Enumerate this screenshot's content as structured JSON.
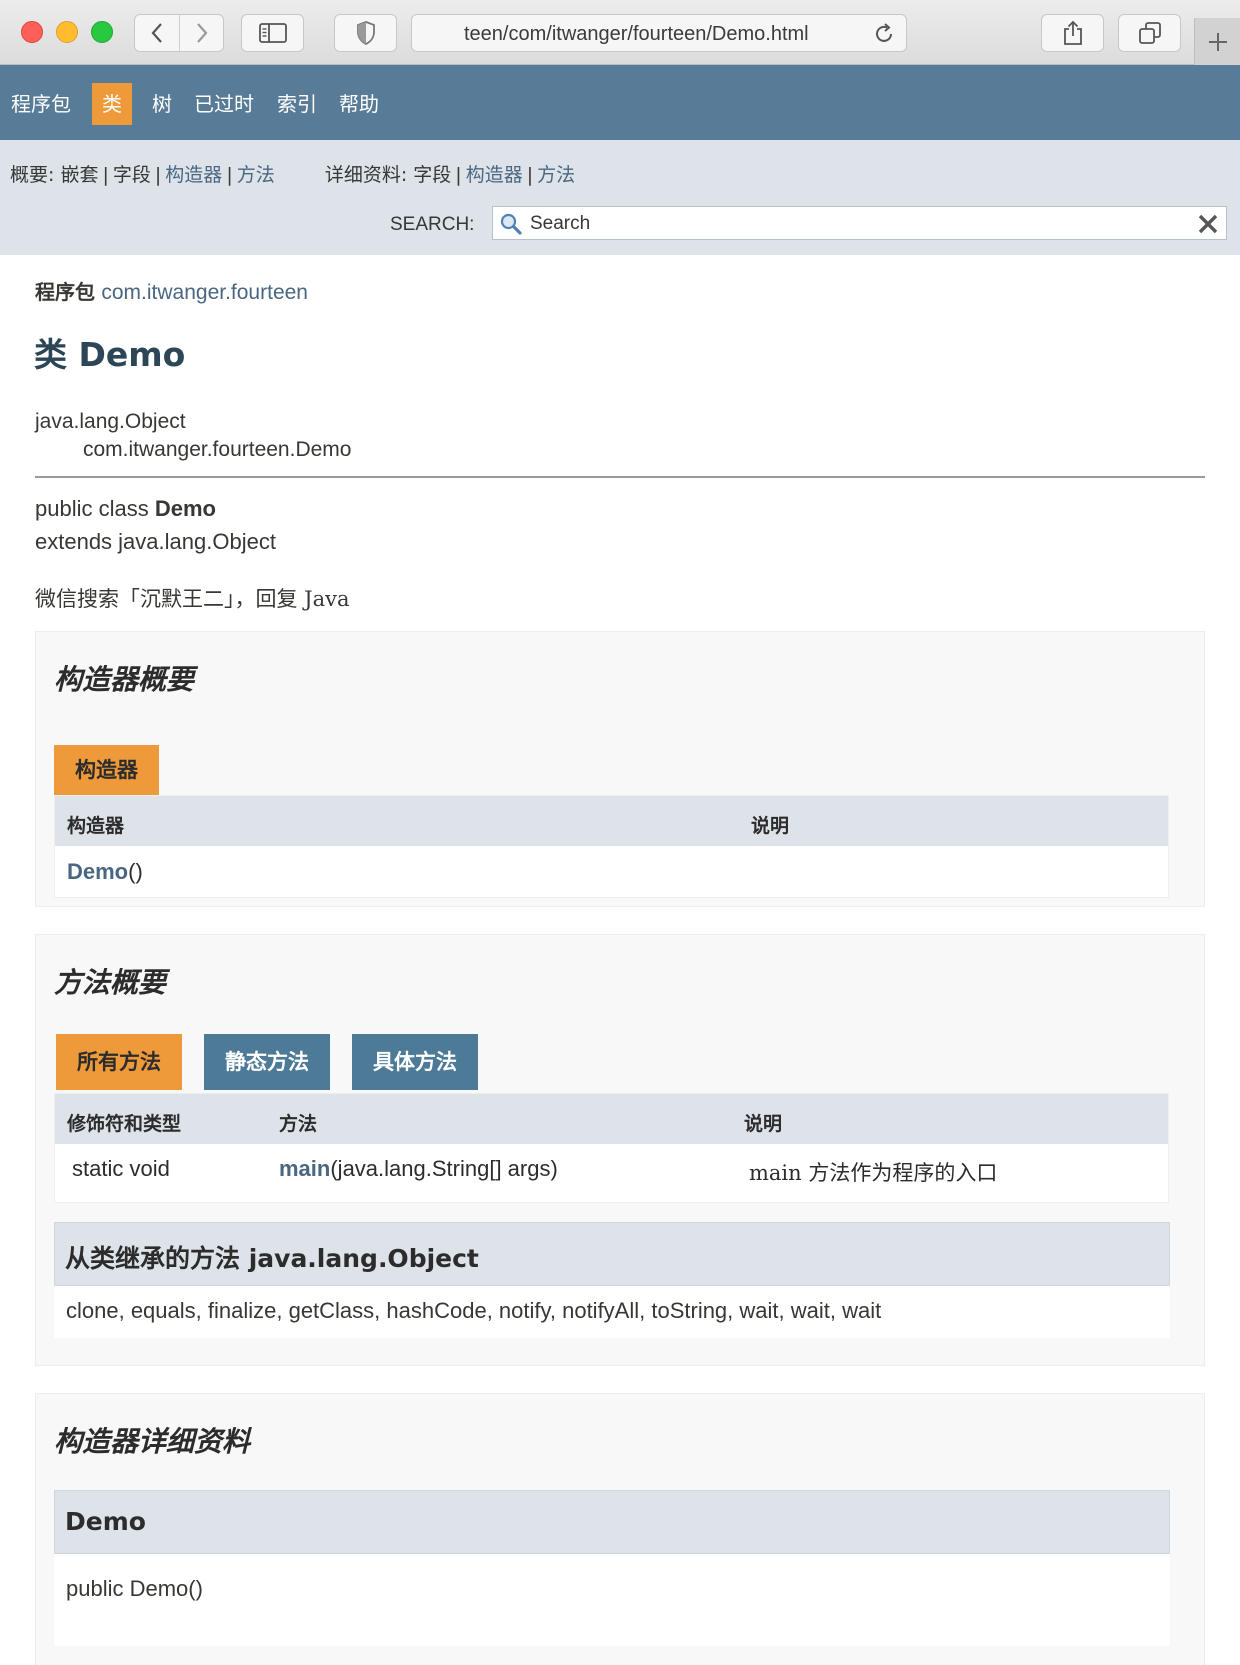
{
  "browser": {
    "url": "teen/com/itwanger/fourteen/Demo.html"
  },
  "topnav": {
    "items": [
      "程序包",
      "类",
      "树",
      "已过时",
      "索引",
      "帮助"
    ],
    "active": "类"
  },
  "subnav": {
    "summary_label": "概要:",
    "summary_items": [
      "嵌套",
      "字段",
      "构造器",
      "方法"
    ],
    "detail_label": "详细资料:",
    "detail_items": [
      "字段",
      "构造器",
      "方法"
    ],
    "search_label": "SEARCH:",
    "search_placeholder": "Search"
  },
  "header": {
    "package_label": "程序包",
    "package_name": "com.itwanger.fourteen",
    "class_title": "类 Demo"
  },
  "hierarchy": {
    "parent": "java.lang.Object",
    "child": "com.itwanger.fourteen.Demo"
  },
  "declaration": {
    "prefix": "public class ",
    "name": "Demo",
    "extends": "extends java.lang.Object",
    "description": "微信搜索「沉默王二」，回复 Java"
  },
  "constructor_summary": {
    "title": "构造器概要",
    "caption": "构造器",
    "columns": [
      "构造器",
      "说明"
    ],
    "rows": [
      {
        "name": "Demo",
        "suffix": "()"
      }
    ]
  },
  "method_summary": {
    "title": "方法概要",
    "tabs": [
      "所有方法",
      "静态方法",
      "具体方法"
    ],
    "columns": [
      "修饰符和类型",
      "方法",
      "说明"
    ],
    "rows": [
      {
        "modifier": "static void",
        "name": "main",
        "params": "(java.lang.String[] args)",
        "description": "main 方法作为程序的入口"
      }
    ],
    "inherited_title": "从类继承的方法 java.lang.Object",
    "inherited_methods": "clone, equals, finalize, getClass, hashCode, notify, notifyAll, toString, wait, wait, wait"
  },
  "constructor_detail": {
    "title": "构造器详细资料",
    "name": "Demo",
    "signature": "public Demo()"
  },
  "colors": {
    "nav_bg": "#587b97",
    "accent": "#ee9a3a",
    "tab_blue": "#4d7a97",
    "subnav_bg": "#dee3e9",
    "link": "#4a6782"
  }
}
